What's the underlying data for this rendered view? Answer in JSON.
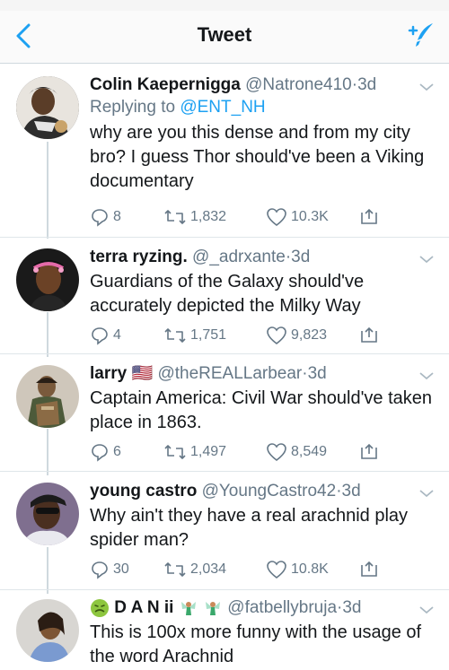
{
  "nav": {
    "title": "Tweet",
    "back_icon": "chevron-left-icon",
    "compose_icon": "compose-tweet-icon",
    "accent": "#1da1f2"
  },
  "tweets": [
    {
      "name": "Colin Kaepernigga",
      "handle": "@Natrone410",
      "sep": "·",
      "time": "3d",
      "reply_prefix": "Replying to",
      "reply_to": "@ENT_NH",
      "text": "why are you this dense and from my city bro? I guess Thor should've been a Viking documentary",
      "replies": "8",
      "retweets": "1,832",
      "likes": "10.3K"
    },
    {
      "name": "terra ryzing.",
      "handle": "@_adrxante",
      "sep": "·",
      "time": "3d",
      "text": "Guardians of the Galaxy should've accurately depicted the Milky Way",
      "replies": "4",
      "retweets": "1,751",
      "likes": "9,823"
    },
    {
      "name": "larry",
      "flag": "🇺🇸",
      "handle": "@theREALLarbear",
      "sep": "·",
      "time": "3d",
      "text": "Captain America: Civil War should've taken place in 1863.",
      "replies": "6",
      "retweets": "1,497",
      "likes": "8,549"
    },
    {
      "name": "young castro",
      "handle": "@YoungCastro42",
      "sep": "·",
      "time": "3d",
      "text": "Why ain't they have a real arachnid play spider man?",
      "replies": "30",
      "retweets": "2,034",
      "likes": "10.8K"
    },
    {
      "name": "D A N ii",
      "handle": "@fatbellybruja",
      "sep": "·",
      "time": "3d",
      "text": "This is 100x more funny with the usage of the word Arachnid"
    }
  ]
}
